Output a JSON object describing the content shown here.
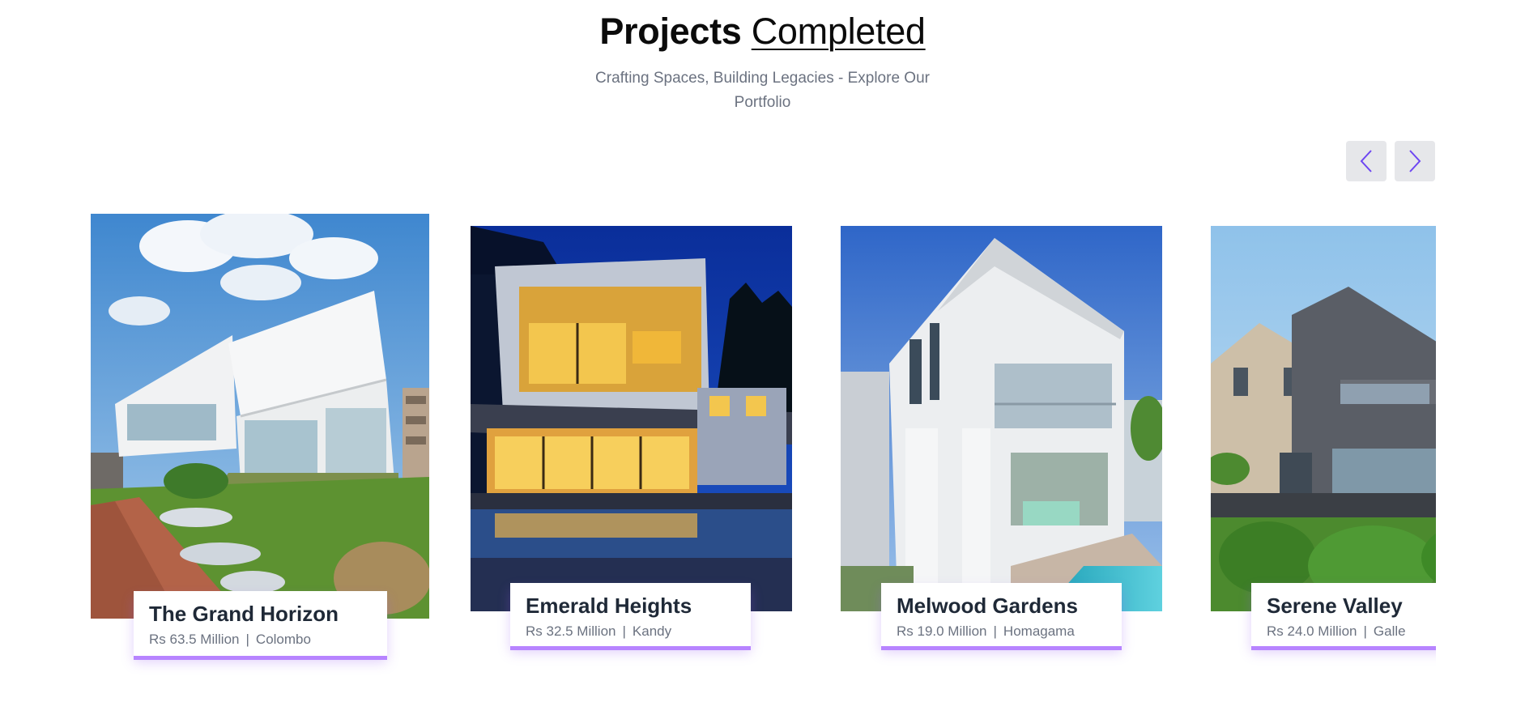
{
  "section": {
    "title_bold": "Projects",
    "title_light": "Completed",
    "subtitle": "Crafting Spaces, Building Legacies - Explore Our Portfolio"
  },
  "nav": {
    "prev_icon": "chevron-left-icon",
    "next_icon": "chevron-right-icon",
    "accent": "#6d46f2",
    "button_bg": "#e6e7ea"
  },
  "projects": [
    {
      "name": "The Grand Horizon",
      "price": "Rs 63.5 Million",
      "location": "Colombo"
    },
    {
      "name": "Emerald Heights",
      "price": "Rs 32.5 Million",
      "location": "Kandy"
    },
    {
      "name": "Melwood Gardens",
      "price": "Rs 19.0 Million",
      "location": "Homagama"
    },
    {
      "name": "Serene Valley",
      "price": "Rs 24.0 Million",
      "location": "Galle"
    }
  ],
  "colors": {
    "card_shadow": "#b784ff",
    "text_muted": "#6b7280",
    "text_dark": "#1f2937"
  }
}
